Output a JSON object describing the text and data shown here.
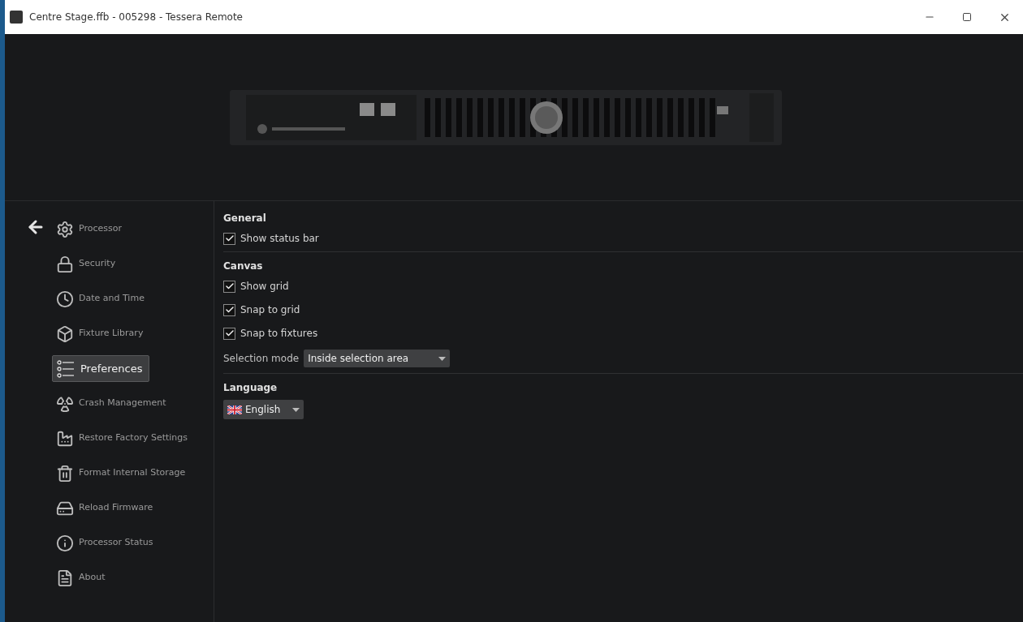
{
  "window": {
    "title": "Centre Stage.ffb - 005298 - Tessera Remote"
  },
  "sidebar": {
    "items": [
      {
        "label": "Processor",
        "selected": false
      },
      {
        "label": "Security",
        "selected": false
      },
      {
        "label": "Date and Time",
        "selected": false
      },
      {
        "label": "Fixture Library",
        "selected": false
      },
      {
        "label": "Preferences",
        "selected": true
      },
      {
        "label": "Crash Management",
        "selected": false
      },
      {
        "label": "Restore Factory Settings",
        "selected": false
      },
      {
        "label": "Format Internal Storage",
        "selected": false
      },
      {
        "label": "Reload Firmware",
        "selected": false
      },
      {
        "label": "Processor Status",
        "selected": false
      },
      {
        "label": "About",
        "selected": false
      }
    ]
  },
  "sections": [
    {
      "title": "General",
      "settings": [
        {
          "kind": "checkbox",
          "label": "Show status bar",
          "checked": true
        }
      ]
    },
    {
      "title": "Canvas",
      "settings": [
        {
          "kind": "checkbox",
          "label": "Show grid",
          "checked": true
        },
        {
          "kind": "checkbox",
          "label": "Snap to grid",
          "checked": true
        },
        {
          "kind": "checkbox",
          "label": "Snap to fixtures",
          "checked": true
        },
        {
          "kind": "dropdown",
          "label": "Selection mode",
          "value": "Inside selection area"
        }
      ]
    },
    {
      "title": "Language",
      "settings": [
        {
          "kind": "language",
          "value": "English"
        }
      ]
    }
  ]
}
